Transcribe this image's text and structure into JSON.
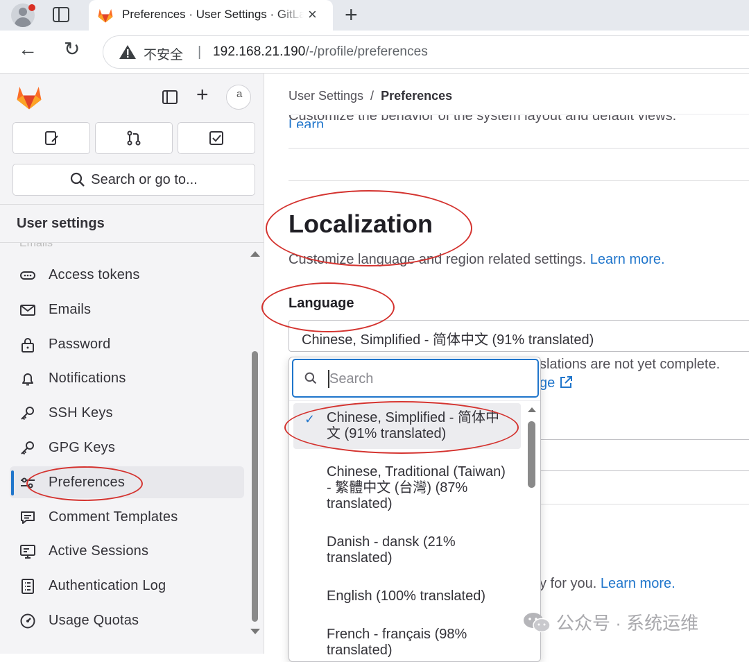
{
  "browser": {
    "tab_title": "Preferences · User Settings · GitLab",
    "tab_close": "×",
    "new_tab": "+",
    "security_label": "不安全",
    "url_host": "192.168.21.190",
    "url_path": "/-/profile/preferences",
    "back": "←",
    "reload": "↻"
  },
  "sidebar": {
    "plus": "+",
    "avatar_text": "a",
    "search_placeholder": "Search or go to...",
    "section_title": "User settings",
    "hidden_item": "Emails",
    "items": [
      {
        "label": "Access tokens",
        "icon": "token-icon"
      },
      {
        "label": "Emails",
        "icon": "mail-icon"
      },
      {
        "label": "Password",
        "icon": "lock-icon"
      },
      {
        "label": "Notifications",
        "icon": "bell-icon"
      },
      {
        "label": "SSH Keys",
        "icon": "key-icon"
      },
      {
        "label": "GPG Keys",
        "icon": "key-icon"
      },
      {
        "label": "Preferences",
        "icon": "preferences-icon",
        "active": true
      },
      {
        "label": "Comment Templates",
        "icon": "comment-icon"
      },
      {
        "label": "Active Sessions",
        "icon": "monitor-icon"
      },
      {
        "label": "Authentication Log",
        "icon": "log-icon"
      },
      {
        "label": "Usage Quotas",
        "icon": "quota-icon"
      }
    ]
  },
  "main": {
    "breadcrumb": {
      "parent": "User Settings",
      "separator": "/",
      "current": "Preferences"
    },
    "cut_text": "Customize the behavior of the system layout and default views.",
    "cut_link": "Learn",
    "localization": {
      "title": "Localization",
      "description": "Customize language and region related settings.",
      "learn_more": "Learn more.",
      "language_label": "Language",
      "selected_language": "Chinese, Simplified - 简体中文 (91% translated)",
      "help_text": "slations are not yet complete.",
      "help_link": "ge",
      "later_text": "y for you.",
      "later_link": "Learn more."
    }
  },
  "dropdown": {
    "search_placeholder": "Search",
    "options": [
      {
        "label": "Chinese, Simplified - 简体中文 (91% translated)",
        "selected": true
      },
      {
        "label": "Chinese, Traditional (Taiwan) - 繁體中文 (台灣) (87% translated)",
        "selected": false
      },
      {
        "label": "Danish - dansk (21% translated)",
        "selected": false
      },
      {
        "label": "English (100% translated)",
        "selected": false
      },
      {
        "label": "French - français (98% translated)",
        "selected": false
      }
    ],
    "check": "✓"
  },
  "watermark": {
    "text": "公众号 · 系统运维"
  },
  "colors": {
    "accent": "#1f75cb",
    "annotation": "#d4332f",
    "gitlab_orange": "#e24329"
  }
}
